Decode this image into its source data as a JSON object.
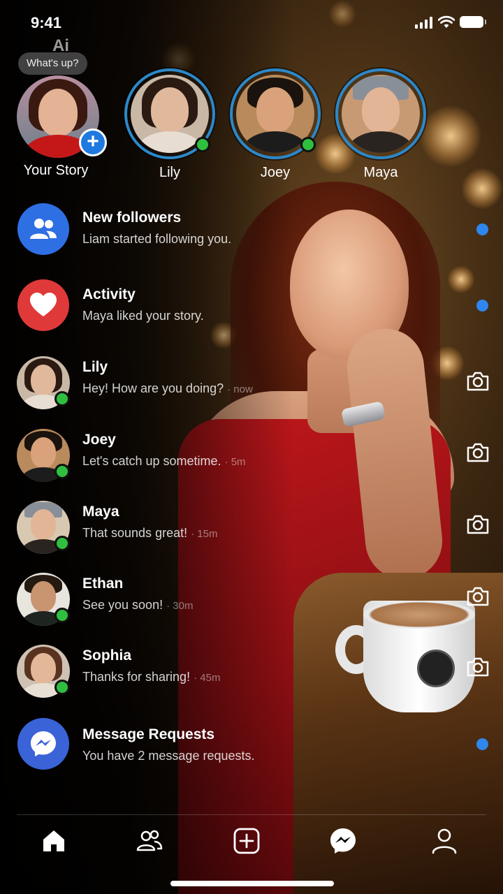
{
  "status_bar": {
    "time": "9:41"
  },
  "ai_label": "Ai",
  "note_bubble": "What's up?",
  "stories": [
    {
      "name": "Your Story",
      "is_self": true
    },
    {
      "name": "Lily",
      "online": true
    },
    {
      "name": "Joey",
      "online": true
    },
    {
      "name": "Maya",
      "online": false
    }
  ],
  "list": [
    {
      "id": "new-followers",
      "title": "New followers",
      "subtitle": "Liam started following you.",
      "time": "",
      "icon": "people-icon",
      "accent": "#2f6fe4",
      "trailing": "unread-dot"
    },
    {
      "id": "activity",
      "title": "Activity",
      "subtitle": "Maya liked your story.",
      "time": "",
      "icon": "heart-icon",
      "accent": "#e0393a",
      "trailing": "unread-dot"
    },
    {
      "id": "lily",
      "title": "Lily",
      "subtitle": "Hey! How are you doing?",
      "time": "· now",
      "icon": "avatar",
      "trailing": "camera-icon"
    },
    {
      "id": "joey",
      "title": "Joey",
      "subtitle": "Let's catch up sometime.",
      "time": "· 5m",
      "icon": "avatar",
      "trailing": "camera-icon"
    },
    {
      "id": "maya",
      "title": "Maya",
      "subtitle": "That sounds great!",
      "time": "· 15m",
      "icon": "avatar",
      "trailing": "camera-icon"
    },
    {
      "id": "ethan",
      "title": "Ethan",
      "subtitle": "See you soon!",
      "time": "· 30m",
      "icon": "avatar",
      "trailing": "camera-icon"
    },
    {
      "id": "sophia",
      "title": "Sophia",
      "subtitle": "Thanks for sharing!",
      "time": "· 45m",
      "icon": "avatar",
      "trailing": "camera-icon"
    },
    {
      "id": "message-requests",
      "title": "Message Requests",
      "subtitle": "You have 2 message requests.",
      "time": "",
      "icon": "messenger-icon",
      "accent": "#3a63d8",
      "trailing": "unread-dot"
    }
  ],
  "bottom_nav": [
    "home-icon",
    "friends-icon",
    "create-icon",
    "messenger-icon",
    "profile-icon"
  ],
  "colors": {
    "unread": "#2f86ee",
    "online": "#2fbf3f",
    "story_ring": "#2c88c9"
  }
}
